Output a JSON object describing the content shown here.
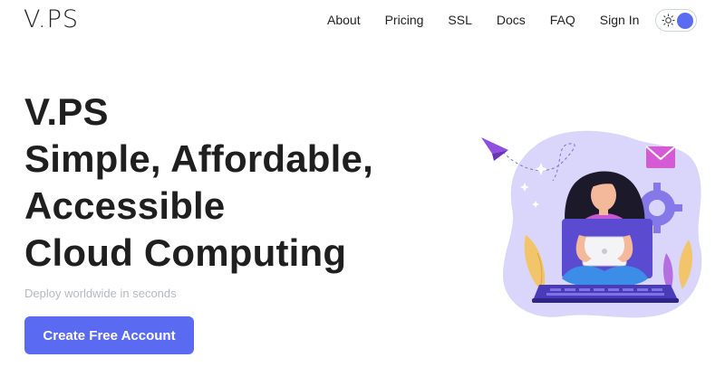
{
  "header": {
    "logo": "V.PS",
    "nav": [
      "About",
      "Pricing",
      "SSL",
      "Docs",
      "FAQ",
      "Sign In"
    ],
    "theme_toggle": {
      "icon": "sun-icon",
      "state": "dark-knob"
    }
  },
  "hero": {
    "title_lines": [
      "V.PS",
      "Simple, Affordable,",
      "Accessible",
      "Cloud Computing"
    ],
    "tagline": "Deploy worldwide in seconds",
    "cta_label": "Create Free Account"
  },
  "colors": {
    "accent": "#5b6bf1",
    "blob": "#d9d5fb",
    "text": "#1f1f1f",
    "muted": "#b6b9c0"
  }
}
